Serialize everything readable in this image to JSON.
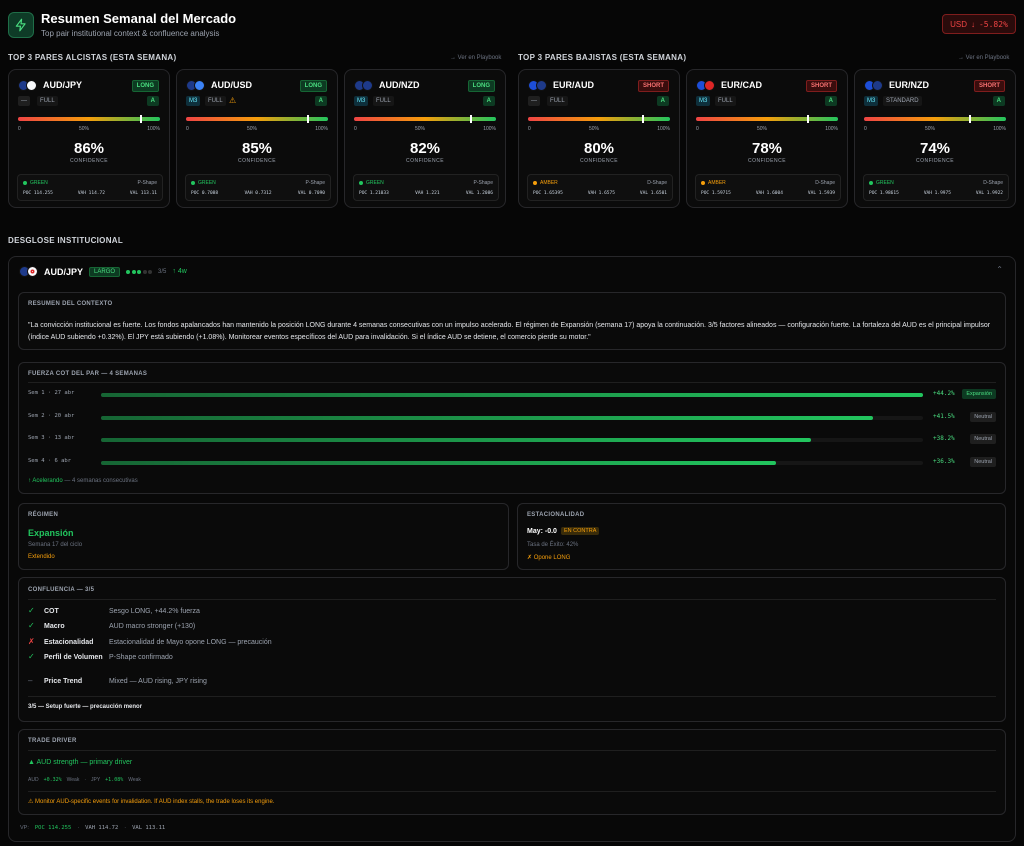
{
  "header": {
    "title": "Resumen Semanal del Mercado",
    "subtitle": "Top pair institutional context & confluence analysis",
    "usd_label": "USD",
    "usd_change": "-5.82%"
  },
  "bullish": {
    "title": "TOP 3 PARES ALCISTAS (ESTA SEMANA)",
    "link": "→ Ver en Playbook"
  },
  "bearish": {
    "title": "TOP 3 PARES BAJISTAS (ESTA SEMANA)",
    "link": "→ Ver en Playbook"
  },
  "ticks": [
    "0",
    "50%",
    "100%"
  ],
  "confidence_label": "CONFIDENCE",
  "cards": [
    {
      "pair": "AUD/JPY",
      "dir": "LONG",
      "mtag": "—",
      "type": "FULL",
      "grade": "A",
      "confidence": "86%",
      "level": 0.86,
      "signal": "GREEN",
      "shape": "P-Shape",
      "poc": "POC 114.255",
      "vah": "VAH 114.72",
      "val": "VAL 113.11",
      "flag1": "#1e3a8a",
      "flag2": "#f8fafc",
      "warn": false
    },
    {
      "pair": "AUD/USD",
      "dir": "LONG",
      "mtag": "M3",
      "type": "FULL",
      "grade": "A",
      "confidence": "85%",
      "level": 0.85,
      "signal": "GREEN",
      "shape": "P-Shape",
      "poc": "POC 0.7088",
      "vah": "VAH 0.7312",
      "val": "VAL 0.7090",
      "flag1": "#1e3a8a",
      "flag2": "#3b82f6",
      "warn": true
    },
    {
      "pair": "AUD/NZD",
      "dir": "LONG",
      "mtag": "M3",
      "type": "FULL",
      "grade": "A",
      "confidence": "82%",
      "level": 0.82,
      "signal": "GREEN",
      "shape": "P-Shape",
      "poc": "POC 1.21033",
      "vah": "VAH 1.221",
      "val": "VAL 1.2086",
      "flag1": "#1e3a8a",
      "flag2": "#1e3a8a",
      "warn": false
    },
    {
      "pair": "EUR/AUD",
      "dir": "SHORT",
      "mtag": "—",
      "type": "FULL",
      "grade": "A",
      "confidence": "80%",
      "level": 0.8,
      "signal": "AMBER",
      "shape": "D-Shape",
      "poc": "POC 1.65395",
      "vah": "VAH 1.6575",
      "val": "VAL 1.6501",
      "flag1": "#1d4ed8",
      "flag2": "#1e3a8a",
      "warn": false
    },
    {
      "pair": "EUR/CAD",
      "dir": "SHORT",
      "mtag": "M3",
      "type": "FULL",
      "grade": "A",
      "confidence": "78%",
      "level": 0.78,
      "signal": "AMBER",
      "shape": "D-Shape",
      "poc": "POC 1.59715",
      "vah": "VAH 1.6004",
      "val": "VAL 1.5939",
      "flag1": "#1d4ed8",
      "flag2": "#dc2626",
      "warn": false
    },
    {
      "pair": "EUR/NZD",
      "dir": "SHORT",
      "mtag": "M3",
      "type": "STANDARD",
      "grade": "A",
      "confidence": "74%",
      "level": 0.74,
      "signal": "GREEN",
      "shape": "D-Shape",
      "poc": "POC 1.98615",
      "vah": "VAH 1.9975",
      "val": "VAL 1.9922",
      "flag1": "#1d4ed8",
      "flag2": "#1e3a8a",
      "warn": false
    }
  ],
  "inst": {
    "section": "DESGLOSE INSTITUCIONAL",
    "pair": "AUD/JPY",
    "dir": "LARGO",
    "score": "3/5",
    "weeks": "↑ 4w",
    "context_label": "RESUMEN DEL CONTEXTO",
    "context": "\"La convicción institucional es fuerte. Los fondos apalancados han mantenido la posición LONG durante 4 semanas consecutivas con un impulso acelerado. El régimen de Expansión (semana 17) apoya la continuación. 3/5 factores alineados — configuración fuerte. La fortaleza del AUD es el principal impulsor (índice AUD subiendo +0.32%). El JPY está subiendo (+1.08%). Monitorear eventos específicos del AUD para invalidación. Si el índice AUD se detiene, el comercio pierde su motor.\"",
    "cot_label": "FUERZA COT DEL PAR — 4 SEMANAS",
    "cot": [
      {
        "week": "Sem 1 · 27 abr",
        "value": 44.2,
        "label": "+44.2%",
        "state": "Expansión"
      },
      {
        "week": "Sem 2 · 20 abr",
        "value": 41.5,
        "label": "+41.5%",
        "state": "Neutral"
      },
      {
        "week": "Sem 3 · 13 abr",
        "value": 38.2,
        "label": "+38.2%",
        "state": "Neutral"
      },
      {
        "week": "Sem 4 · 6 abr",
        "value": 36.3,
        "label": "+36.3%",
        "state": "Neutral"
      }
    ],
    "accel": "↑ Acelerando",
    "accel_note": "— 4 semanas consecutivas",
    "regime_label": "RÉGIMEN",
    "regime": "Expansión",
    "regime_week": "Semana 17 del ciclo",
    "regime_state": "Extendido",
    "season_label": "ESTACIONALIDAD",
    "season_val": "May: -0.0",
    "season_badge": "EN CONTRA",
    "season_rate": "Tasa de Éxito: 42%",
    "season_opp": "✗ Opone LONG",
    "conf_label": "CONFLUENCIA — 3/5",
    "conf": [
      {
        "mark": "✓",
        "name": "COT",
        "desc": "Sesgo LONG, +44.2% fuerza",
        "ok": "g"
      },
      {
        "mark": "✓",
        "name": "Macro",
        "desc": "AUD macro stronger (+130)",
        "ok": "g"
      },
      {
        "mark": "✗",
        "name": "Estacionalidad",
        "desc": "Estacionalidad de Mayo opone LONG — precaución",
        "ok": "r"
      },
      {
        "mark": "✓",
        "name": "Perfil de Volumen",
        "desc": "P-Shape confirmado",
        "ok": "g"
      },
      {
        "mark": "–",
        "name": "Price Trend",
        "desc": "Mixed — AUD rising, JPY rising",
        "ok": "n"
      }
    ],
    "conf_summary": "3/5 — Setup fuerte — precaución menor",
    "driver_label": "TRADE DRIVER",
    "driver": "▲ AUD strength — primary driver",
    "aud_k": "AUD",
    "aud_v": "+0.32%",
    "aud_w": "Weak",
    "jpy_k": "JPY",
    "jpy_v": "+1.08%",
    "jpy_w": "Weak",
    "driver_warn": "⚠ Monitor AUD-specific events for invalidation. If AUD index stalls, the trade loses its engine.",
    "vp_label": "VP:",
    "vp_poc": "POC 114.255",
    "vp_vah": "VAH 114.72",
    "vp_val": "VAL 113.11"
  }
}
